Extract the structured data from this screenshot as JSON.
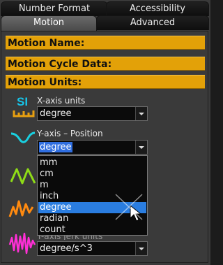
{
  "tabs": {
    "number_format": "Number Format",
    "accessibility": "Accessibility",
    "motion": "Motion",
    "advanced": "Advanced"
  },
  "headers": {
    "motion_name": "Motion Name:",
    "motion_cycle_data": "Motion Cycle Data:",
    "motion_units": "Motion Units:"
  },
  "x_axis": {
    "label": "X-axis units",
    "icon_text": "SI",
    "value": "degree"
  },
  "y_position": {
    "label": "Y-axis – Position",
    "value": "degree"
  },
  "y_jerk": {
    "label": "Y-axis Jerk units",
    "value": "degree/s^3"
  },
  "dropdown_options": [
    "mm",
    "cm",
    "m",
    "inch",
    "degree",
    "radian",
    "count"
  ],
  "highlighted_option": "degree",
  "colors": {
    "header_bar": "#e3a108",
    "si_icon": "#17c4e8",
    "ruler_icon": "#e8a010",
    "position_icon": "#19d0e0",
    "velocity_icon": "#8fdc17",
    "accel_icon": "#ff8a10",
    "jerk_icon": "#ff2fd6",
    "highlight": "#2a7de0"
  }
}
